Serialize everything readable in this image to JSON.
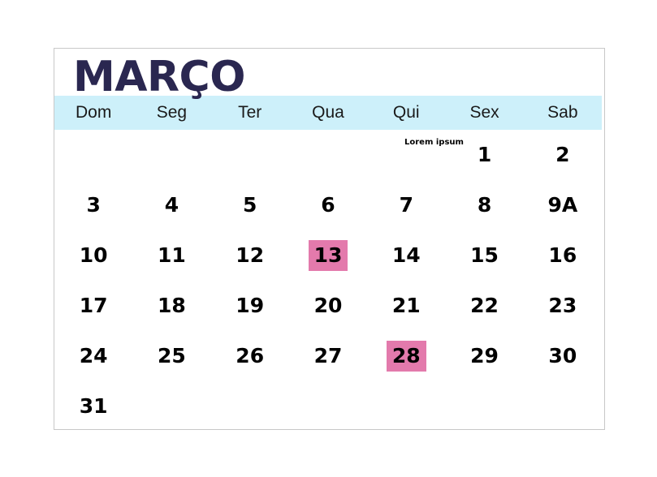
{
  "calendar": {
    "title": "MARÇO",
    "weekdays": [
      "Dom",
      "Seg",
      "Ter",
      "Qua",
      "Qui",
      "Sex",
      "Sab"
    ],
    "colors": {
      "title": "#2a2750",
      "header_band": "#cdf0fa",
      "highlight": "#e37aac",
      "day_text": "#000000",
      "frame_border": "#c8c8c8",
      "background": "#ffffff"
    },
    "note": {
      "text": "Lorem ipsum"
    },
    "weeks": [
      [
        {
          "label": "",
          "highlighted": false
        },
        {
          "label": "",
          "highlighted": false
        },
        {
          "label": "",
          "highlighted": false
        },
        {
          "label": "",
          "highlighted": false
        },
        {
          "label": "",
          "highlighted": false
        },
        {
          "label": "1",
          "highlighted": false
        },
        {
          "label": "2",
          "highlighted": false
        }
      ],
      [
        {
          "label": "3",
          "highlighted": false
        },
        {
          "label": "4",
          "highlighted": false
        },
        {
          "label": "5",
          "highlighted": false
        },
        {
          "label": "6",
          "highlighted": false
        },
        {
          "label": "7",
          "highlighted": false
        },
        {
          "label": "8",
          "highlighted": false
        },
        {
          "label": "9A",
          "highlighted": false
        }
      ],
      [
        {
          "label": "10",
          "highlighted": false
        },
        {
          "label": "11",
          "highlighted": false
        },
        {
          "label": "12",
          "highlighted": false
        },
        {
          "label": "13",
          "highlighted": true
        },
        {
          "label": "14",
          "highlighted": false
        },
        {
          "label": "15",
          "highlighted": false
        },
        {
          "label": "16",
          "highlighted": false
        }
      ],
      [
        {
          "label": "17",
          "highlighted": false
        },
        {
          "label": "18",
          "highlighted": false
        },
        {
          "label": "19",
          "highlighted": false
        },
        {
          "label": "20",
          "highlighted": false
        },
        {
          "label": "21",
          "highlighted": false
        },
        {
          "label": "22",
          "highlighted": false
        },
        {
          "label": "23",
          "highlighted": false
        }
      ],
      [
        {
          "label": "24",
          "highlighted": false
        },
        {
          "label": "25",
          "highlighted": false
        },
        {
          "label": "26",
          "highlighted": false
        },
        {
          "label": "27",
          "highlighted": false
        },
        {
          "label": "28",
          "highlighted": true
        },
        {
          "label": "29",
          "highlighted": false
        },
        {
          "label": "30",
          "highlighted": false
        }
      ],
      [
        {
          "label": "31",
          "highlighted": false
        },
        {
          "label": "",
          "highlighted": false
        },
        {
          "label": "",
          "highlighted": false
        },
        {
          "label": "",
          "highlighted": false
        },
        {
          "label": "",
          "highlighted": false
        },
        {
          "label": "",
          "highlighted": false
        },
        {
          "label": "",
          "highlighted": false
        }
      ]
    ]
  }
}
